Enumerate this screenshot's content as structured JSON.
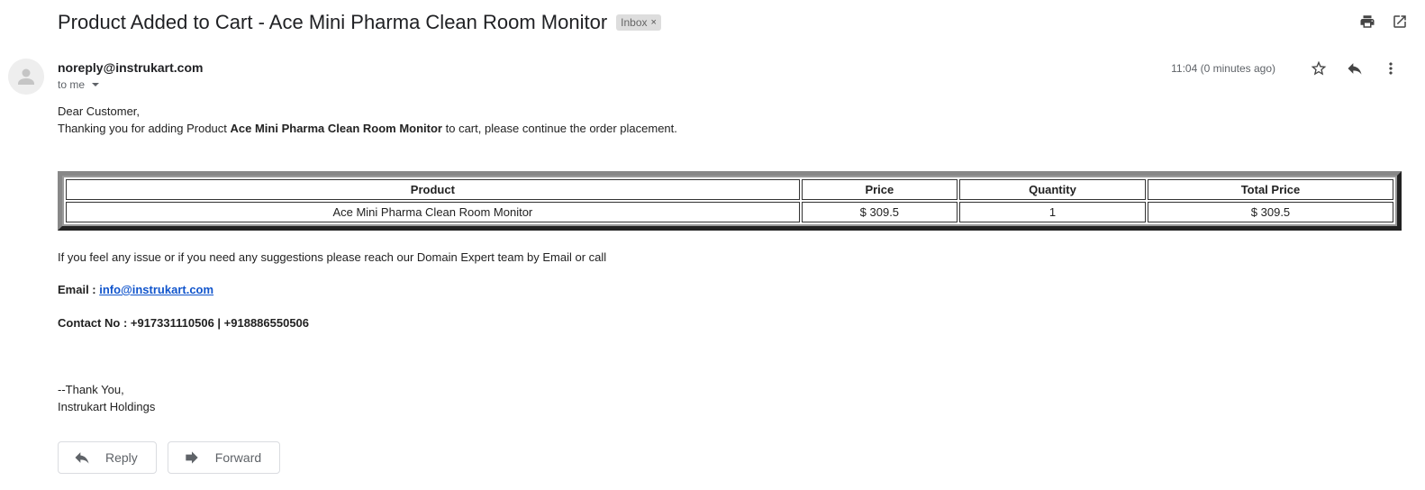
{
  "email": {
    "subject": "Product Added to Cart - Ace Mini Pharma Clean Room Monitor",
    "label": "Inbox",
    "label_close": "×",
    "sender": "noreply@instrukart.com",
    "recipient": "to me",
    "time": "11:04 (0 minutes ago)"
  },
  "body": {
    "greeting": "Dear Customer,",
    "thanks_prefix": "Thanking you for adding Product ",
    "product_name": "Ace Mini Pharma Clean Room Monitor",
    "thanks_suffix": " to cart, please continue the order placement.",
    "table": {
      "headers": [
        "Product",
        "Price",
        "Quantity",
        "Total Price"
      ],
      "rows": [
        [
          "Ace Mini Pharma Clean Room Monitor",
          "$ 309.5",
          "1",
          "$ 309.5"
        ]
      ]
    },
    "issue_text": "If you feel any issue or if you need any suggestions please reach our Domain Expert team by Email or call",
    "email_label": "Email : ",
    "email_link": "info@instrukart.com",
    "contact_text": "Contact No : +917331110506 | +918886550506",
    "signoff_line1": "--Thank You,",
    "signoff_line2": "Instrukart Holdings"
  },
  "actions": {
    "reply": "Reply",
    "forward": "Forward"
  },
  "icons": {
    "print": "print-icon",
    "open_new_window": "open-in-new-window-icon",
    "star": "star-icon",
    "reply": "reply-icon",
    "more": "more-vert-icon",
    "forward": "forward-icon",
    "avatar": "default-avatar-icon"
  }
}
